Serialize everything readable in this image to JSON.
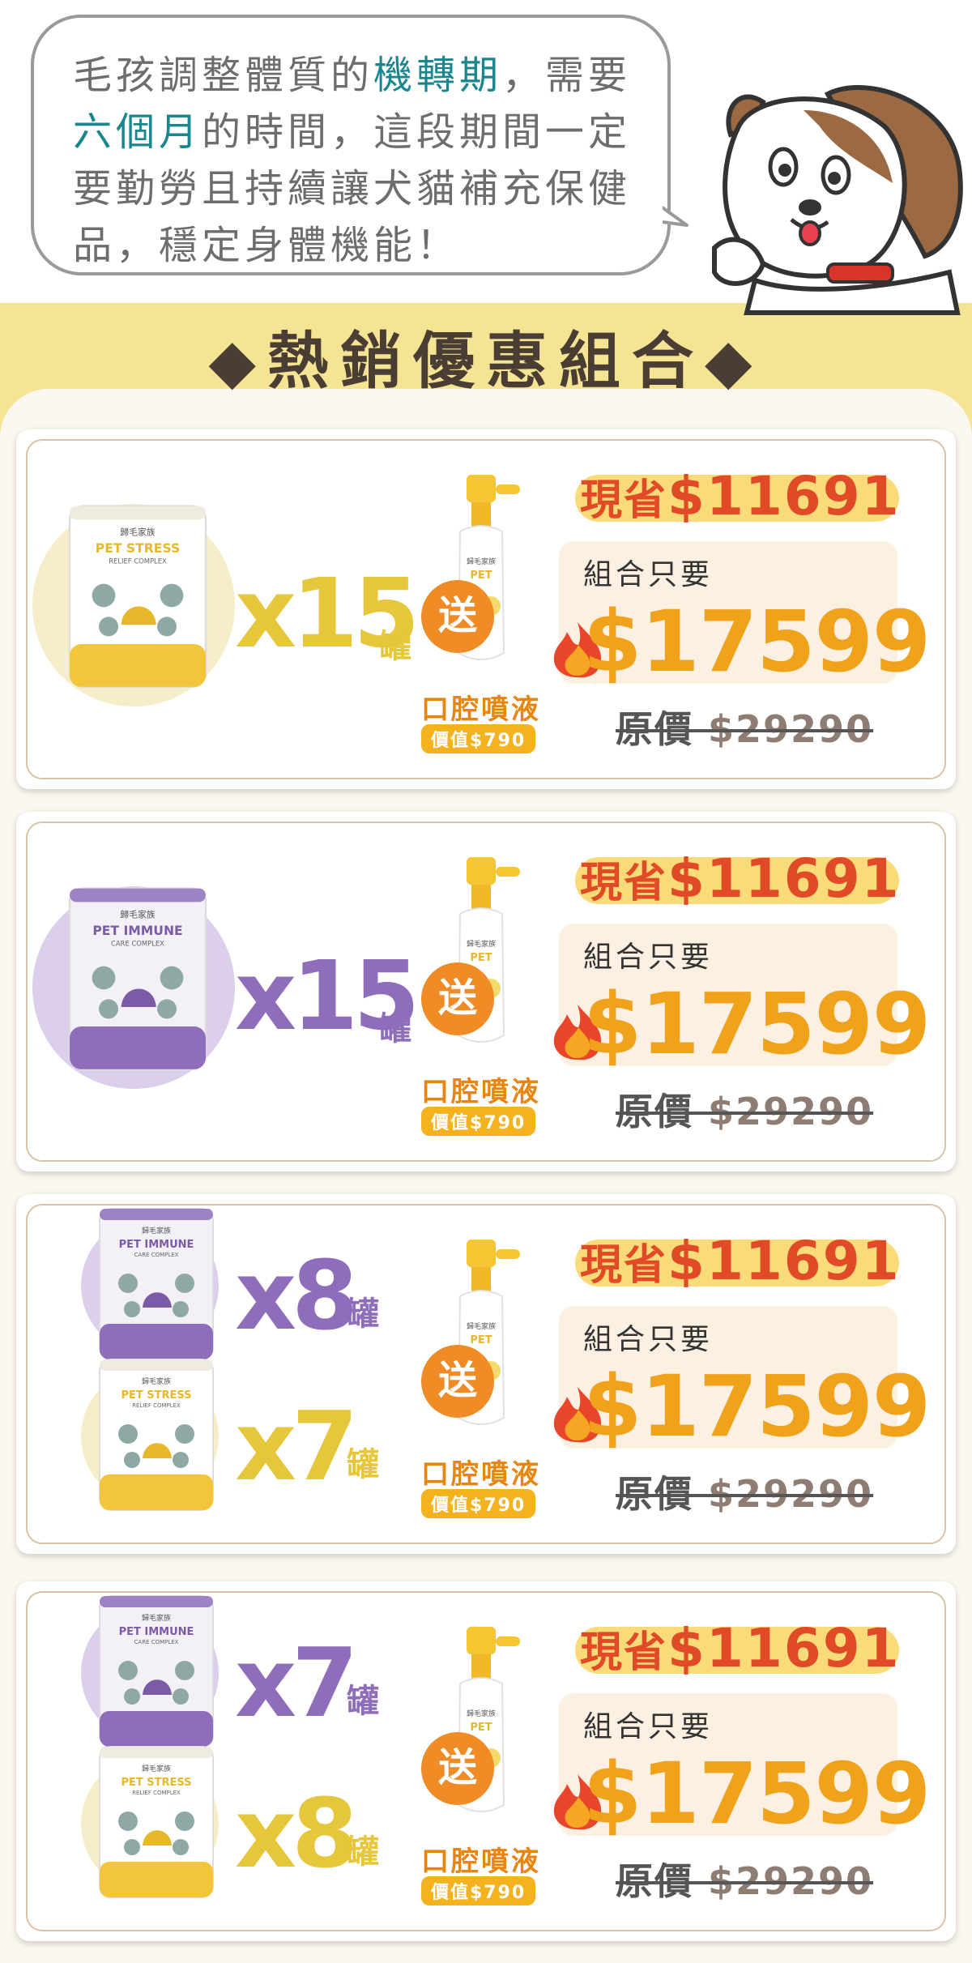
{
  "bubble": {
    "lines": [
      [
        "毛孩調整體質的",
        "機轉期",
        "，需要"
      ],
      [
        "",
        "六個月",
        "的時間，這段期間一定"
      ],
      [
        "要勤勞且持續讓犬貓補充保健",
        "",
        ""
      ],
      [
        "品，穩定身體機能！",
        "",
        ""
      ]
    ]
  },
  "section_title": "◆熱銷優惠組合◆",
  "colors": {
    "yellow": "#e6c63a",
    "purple": "#8e6dbb",
    "orange": "#f0a21a",
    "red": "#e04a26",
    "teal": "#19868e"
  },
  "deals": [
    {
      "products": [
        {
          "kind": "stress",
          "qty": "x15",
          "unit": "罐"
        }
      ],
      "gift_badge": "送",
      "gift_name": "口腔噴液",
      "gift_value": "價值$790",
      "save_label": "現省",
      "save_amount": "$11691",
      "combo_label": "組合只要",
      "combo_price": "$17599",
      "original_label": "原價",
      "original_price": "$29290"
    },
    {
      "products": [
        {
          "kind": "immune",
          "qty": "x15",
          "unit": "罐"
        }
      ],
      "gift_badge": "送",
      "gift_name": "口腔噴液",
      "gift_value": "價值$790",
      "save_label": "現省",
      "save_amount": "$11691",
      "combo_label": "組合只要",
      "combo_price": "$17599",
      "original_label": "原價",
      "original_price": "$29290"
    },
    {
      "products": [
        {
          "kind": "immune",
          "qty": "x8",
          "unit": "罐"
        },
        {
          "kind": "stress",
          "qty": "x7",
          "unit": "罐"
        }
      ],
      "gift_badge": "送",
      "gift_name": "口腔噴液",
      "gift_value": "價值$790",
      "save_label": "現省",
      "save_amount": "$11691",
      "combo_label": "組合只要",
      "combo_price": "$17599",
      "original_label": "原價",
      "original_price": "$29290"
    },
    {
      "products": [
        {
          "kind": "immune",
          "qty": "x7",
          "unit": "罐"
        },
        {
          "kind": "stress",
          "qty": "x8",
          "unit": "罐"
        }
      ],
      "gift_badge": "送",
      "gift_name": "口腔噴液",
      "gift_value": "價值$790",
      "save_label": "現省",
      "save_amount": "$11691",
      "combo_label": "組合只要",
      "combo_price": "$17599",
      "original_label": "原價",
      "original_price": "$29290"
    }
  ],
  "product_labels": {
    "stress": {
      "brand": "歸毛家族",
      "line1": "PET STRESS",
      "line2": "RELIEF COMPLEX"
    },
    "immune": {
      "brand": "歸毛家族",
      "line1": "PET IMMUNE",
      "line2": "CARE COMPLEX"
    },
    "spray": {
      "brand": "歸毛家族",
      "line1": "PET"
    }
  }
}
